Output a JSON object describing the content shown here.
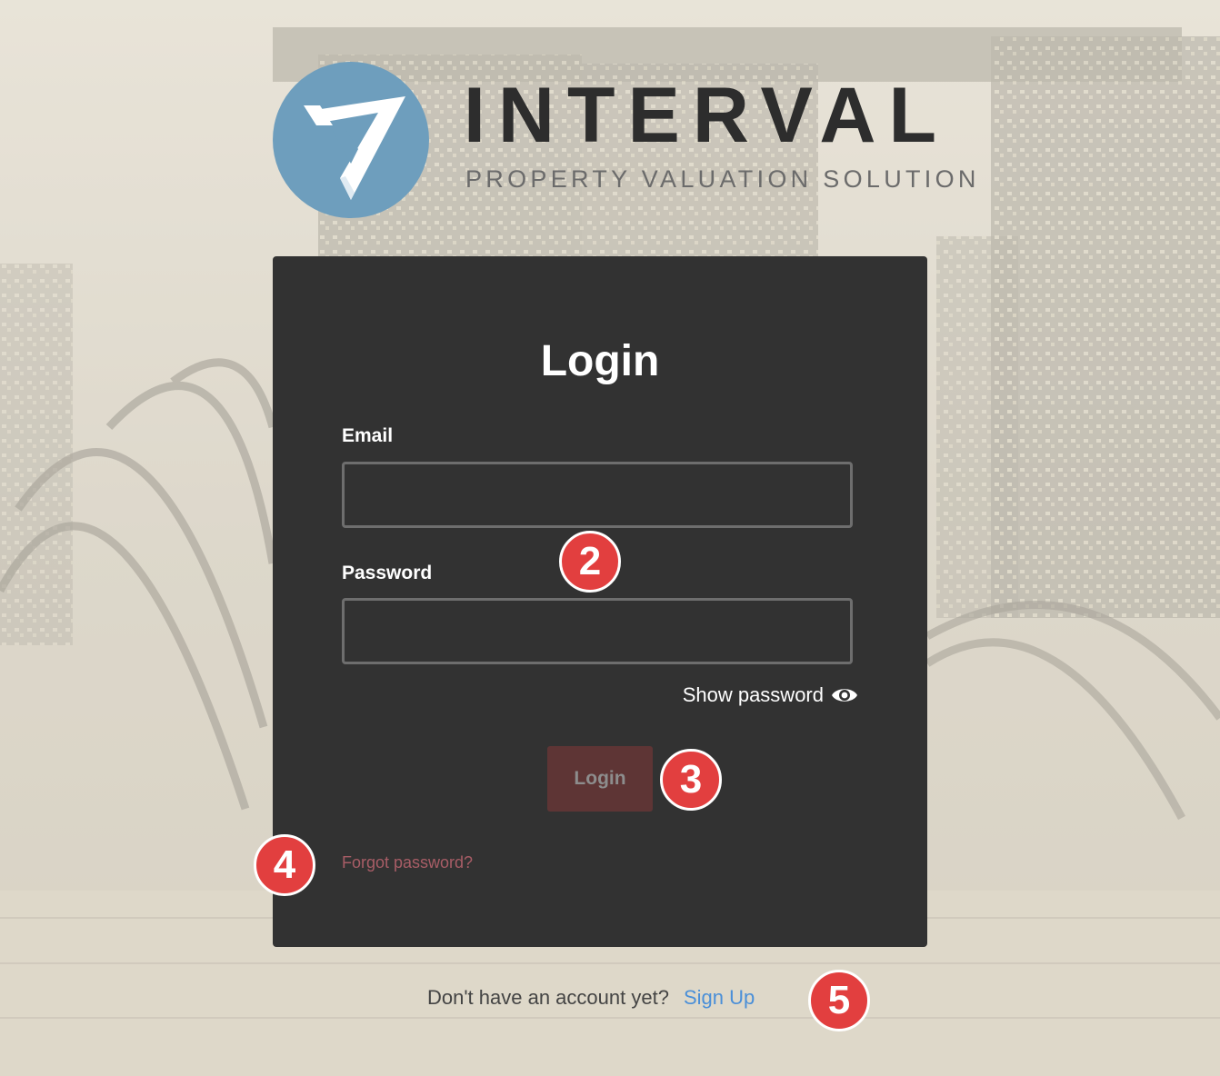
{
  "brand": {
    "name": "INTERVAL",
    "tagline": "PROPERTY VALUATION SOLUTION",
    "logo_icon": "interval-v-logo-icon",
    "logo_color": "#6e9ebd"
  },
  "login_form": {
    "title": "Login",
    "email_label": "Email",
    "email_value": "",
    "password_label": "Password",
    "password_value": "",
    "show_password_label": "Show password",
    "show_password_icon": "eye-icon",
    "submit_label": "Login",
    "forgot_password_label": "Forgot password?"
  },
  "signup": {
    "prompt": "Don't have an account yet?",
    "link_label": "Sign Up"
  },
  "annotations": {
    "marker_2": "2",
    "marker_3": "3",
    "marker_4": "4",
    "marker_5": "5"
  },
  "colors": {
    "card_background": "#323232",
    "login_button_background": "#5e3535",
    "forgot_link": "#a85d66",
    "signup_link": "#4a8fd8",
    "marker": "#e23f3f"
  }
}
